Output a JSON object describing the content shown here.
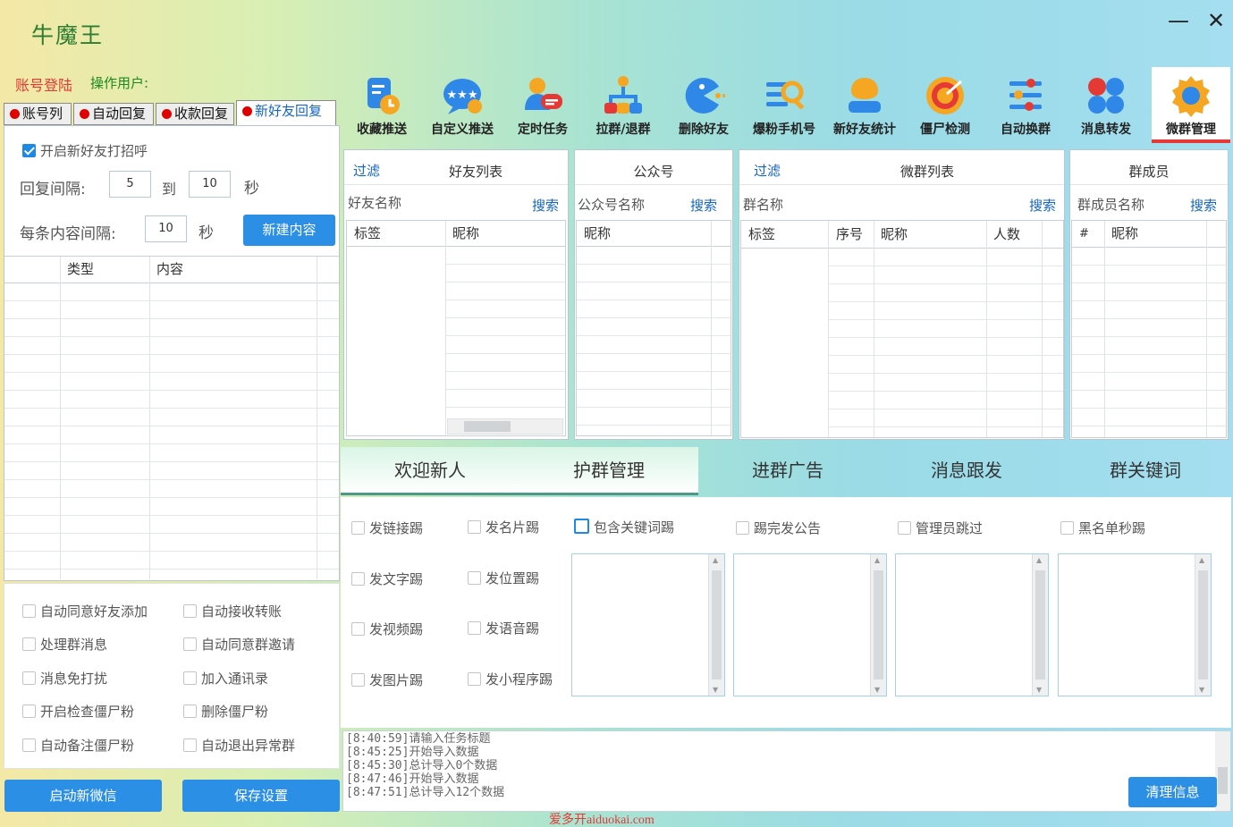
{
  "app": {
    "title": "牛魔王",
    "minimize": "—",
    "close": "✕"
  },
  "account": {
    "login": "账号登陆",
    "operator": "操作用户:"
  },
  "left_tabs": [
    "账号列",
    "自动回复",
    "收款回复",
    "新好友回复"
  ],
  "greeting": {
    "enable_label": "开启新好友打招呼",
    "enabled": true,
    "interval_label": "回复间隔:",
    "interval_from": "5",
    "to_label": "到",
    "interval_to": "10",
    "sec": "秒",
    "each_label": "每条内容间隔:",
    "each_value": "10",
    "new_content_button": "新建内容",
    "columns": [
      "类型",
      "内容"
    ]
  },
  "left_options": [
    [
      "自动同意好友添加",
      "自动接收转账"
    ],
    [
      "处理群消息",
      "自动同意群邀请"
    ],
    [
      "消息免打扰",
      "加入通讯录"
    ],
    [
      "开启检查僵尸粉",
      "删除僵尸粉"
    ],
    [
      "自动备注僵尸粉",
      "自动退出异常群"
    ]
  ],
  "buttons": {
    "start_wechat": "启动新微信",
    "save_settings": "保存设置",
    "clear_info": "清理信息"
  },
  "toolbar": [
    {
      "label": "收藏推送",
      "icon": "favorite-push-icon"
    },
    {
      "label": "自定义推送",
      "icon": "custom-push-icon"
    },
    {
      "label": "定时任务",
      "icon": "scheduled-task-icon"
    },
    {
      "label": "拉群/退群",
      "icon": "group-join-exit-icon"
    },
    {
      "label": "删除好友",
      "icon": "delete-friend-icon"
    },
    {
      "label": "爆粉手机号",
      "icon": "phone-search-icon"
    },
    {
      "label": "新好友统计",
      "icon": "new-friend-stats-icon"
    },
    {
      "label": "僵尸检测",
      "icon": "zombie-detect-icon"
    },
    {
      "label": "自动换群",
      "icon": "auto-switch-group-icon"
    },
    {
      "label": "消息转发",
      "icon": "message-forward-icon"
    },
    {
      "label": "微群管理",
      "icon": "group-manage-icon"
    }
  ],
  "panels": {
    "friends": {
      "filter": "过滤",
      "title": "好友列表",
      "name_label": "好友名称",
      "search": "搜索",
      "columns": [
        "标签",
        "昵称"
      ]
    },
    "official": {
      "title": "公众号",
      "name_label": "公众号名称",
      "search": "搜索",
      "columns": [
        "昵称"
      ]
    },
    "groups": {
      "filter": "过滤",
      "title": "微群列表",
      "name_label": "群名称",
      "search": "搜索",
      "columns": [
        "标签",
        "序号",
        "昵称",
        "人数"
      ]
    },
    "members": {
      "title": "群成员",
      "name_label": "群成员名称",
      "search": "搜索",
      "columns": [
        "#",
        "昵称"
      ]
    }
  },
  "bottom_tabs": [
    "欢迎新人",
    "护群管理",
    "进群广告",
    "消息跟发",
    "群关键词"
  ],
  "kick_options": [
    [
      "发链接踢",
      "发名片踢"
    ],
    [
      "发文字踢",
      "发位置踢"
    ],
    [
      "发视频踢",
      "发语音踢"
    ],
    [
      "发图片踢",
      "发小程序踢"
    ]
  ],
  "kick_header_options": [
    "包含关键词踢",
    "踢完发公告",
    "管理员跳过",
    "黑名单秒踢"
  ],
  "log": [
    "[8:40:59]请输入任务标题",
    "[8:45:25]开始导入数据",
    "[8:45:30]总计导入0个数据",
    "[8:47:46]开始导入数据",
    "[8:47:51]总计导入12个数据"
  ],
  "watermark": "爱多开aiduokai.com",
  "colors": {
    "accent": "#2b8fe6",
    "active_underline": "#e53935",
    "title_green": "#2e7d32"
  }
}
